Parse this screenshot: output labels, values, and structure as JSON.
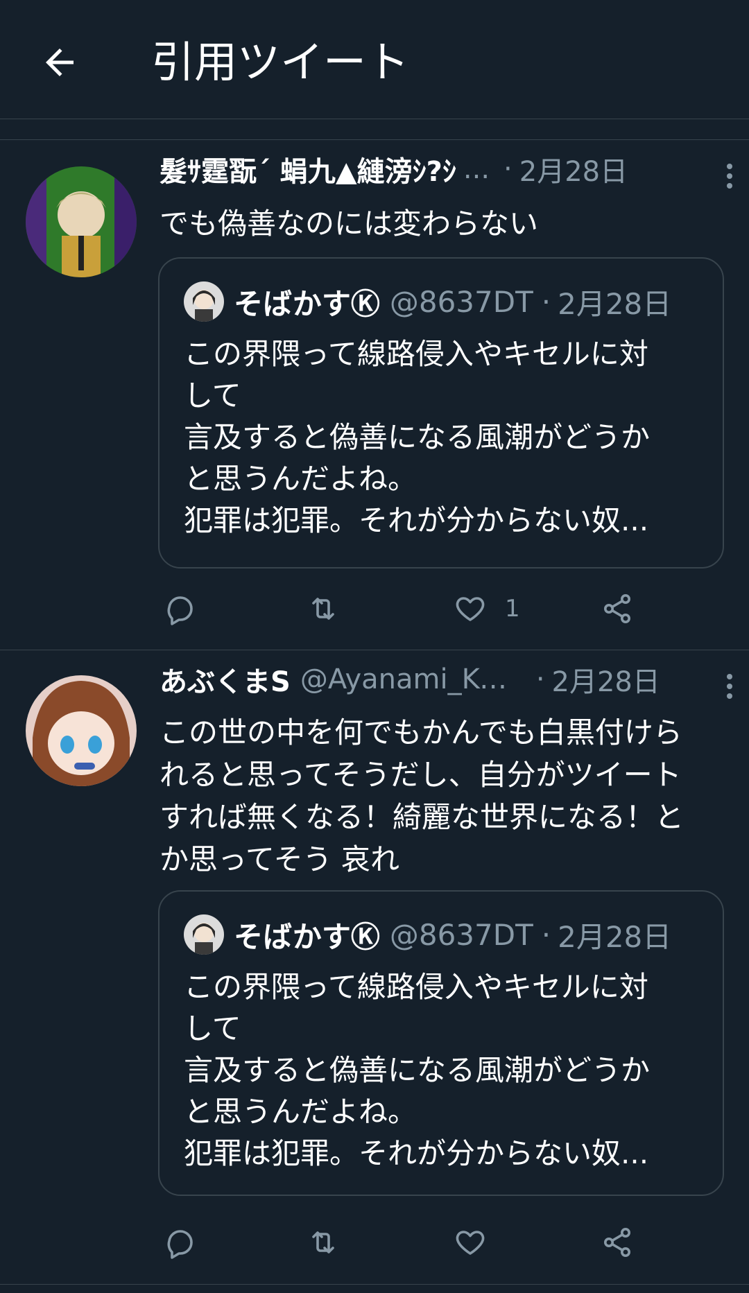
{
  "header": {
    "title": "引用ツイート",
    "back_icon": "arrow-left-icon"
  },
  "colors": {
    "background": "#15202b",
    "border": "#38444d",
    "muted": "#8899a6",
    "text": "#ffffff"
  },
  "tweets": [
    {
      "display_name": "髮ｻ霆翫´ 蜎九▲縺滂ｼ?ｼ",
      "handle": "",
      "truncation": "...",
      "separator": "·",
      "date": "2月28日",
      "text": "でも偽善なのには変わらない",
      "quote": {
        "display_name": "そばかすⓀ",
        "handle": "@8637DT",
        "separator": "·",
        "date": "2月28日",
        "text": "この界隈って線路侵入やキセルに対\nして\n言及すると偽善になる風潮がどうか\nと思うんだよね。\n犯罪は犯罪。それが分からない奴..."
      },
      "actions": {
        "reply_count": "",
        "retweet_count": "",
        "like_count": "1"
      }
    },
    {
      "display_name": "あぶくまS",
      "handle": "@Ayanami_Ka...",
      "separator": "·",
      "date": "2月28日",
      "text": "この世の中を何でもかんでも白黒付けら\nれると思ってそうだし、自分がツイート\nすれば無くなる！綺麗な世界になる！と\nか思ってそう 哀れ",
      "quote": {
        "display_name": "そばかすⓀ",
        "handle": "@8637DT",
        "separator": "·",
        "date": "2月28日",
        "text": "この界隈って線路侵入やキセルに対\nして\n言及すると偽善になる風潮がどうか\nと思うんだよね。\n犯罪は犯罪。それが分からない奴..."
      },
      "actions": {
        "reply_count": "",
        "retweet_count": "",
        "like_count": ""
      }
    }
  ]
}
